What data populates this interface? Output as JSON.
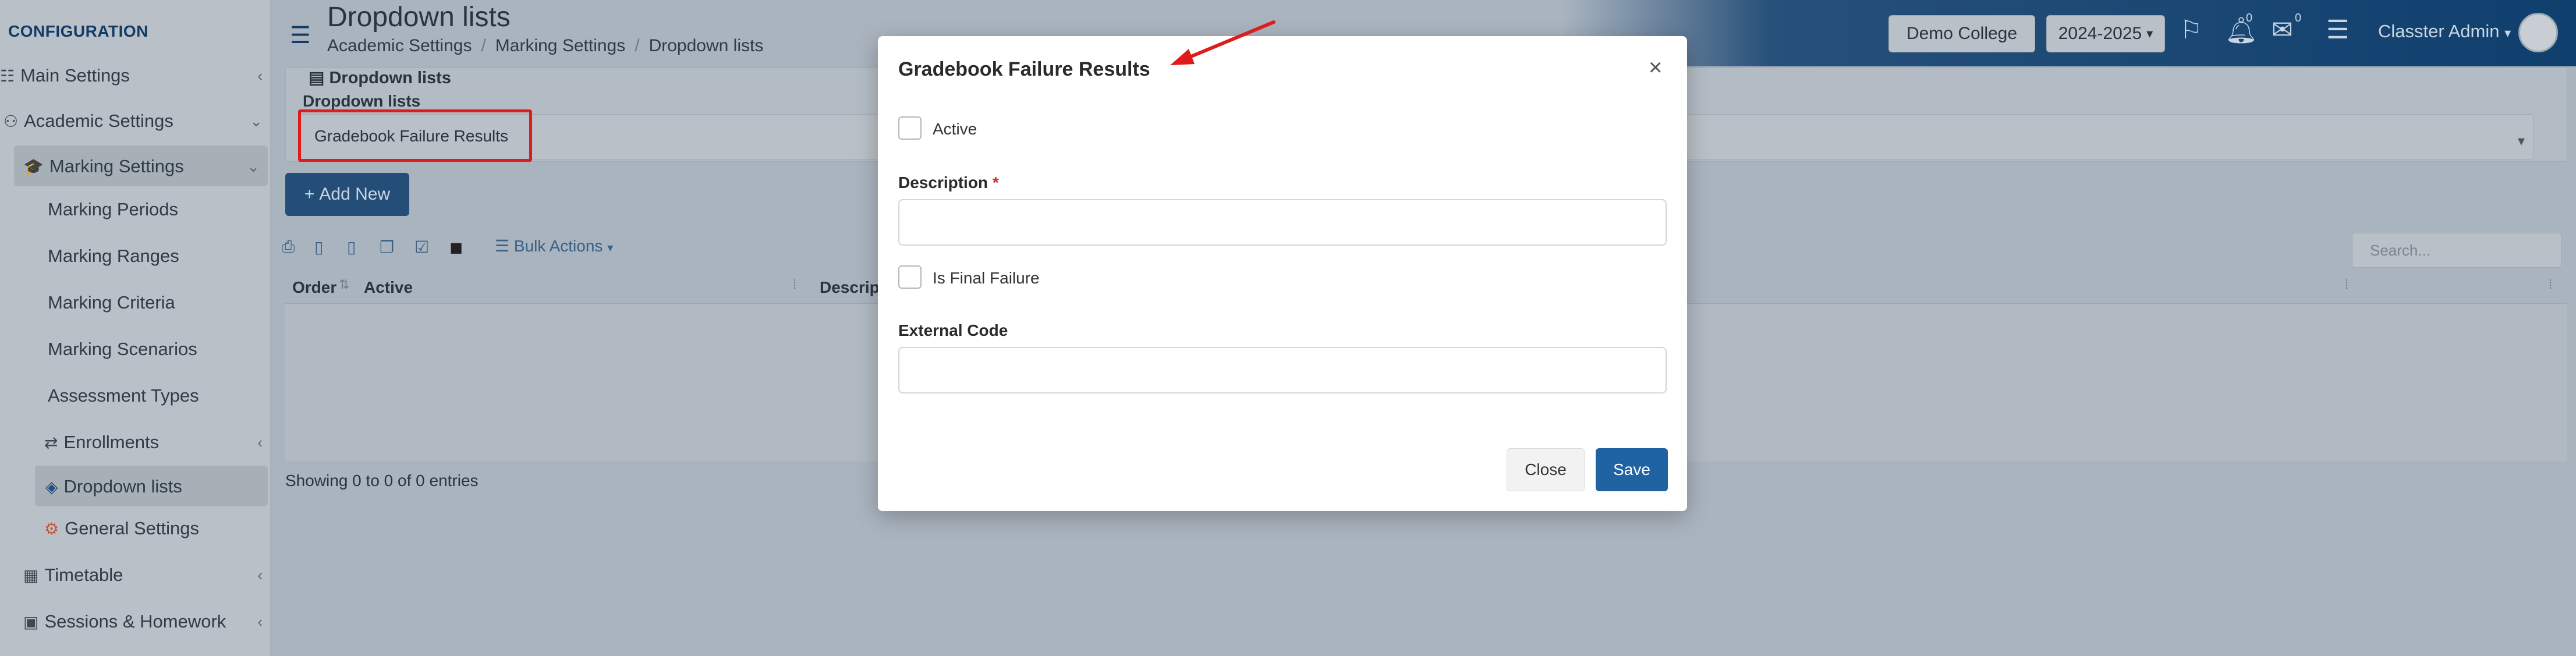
{
  "sidebar": {
    "title": "CONFIGURATION",
    "items": [
      {
        "label": "Main Settings"
      },
      {
        "label": "Academic Settings"
      },
      {
        "label": "Marking Settings"
      },
      {
        "label": "Marking Periods"
      },
      {
        "label": "Marking Ranges"
      },
      {
        "label": "Marking Criteria"
      },
      {
        "label": "Marking Scenarios"
      },
      {
        "label": "Assessment Types"
      },
      {
        "label": "Enrollments"
      },
      {
        "label": "Dropdown lists"
      },
      {
        "label": "General Settings"
      },
      {
        "label": "Timetable"
      },
      {
        "label": "Sessions & Homework"
      }
    ]
  },
  "header": {
    "title": "Dropdown lists",
    "breadcrumb": [
      "Academic Settings",
      "Marking Settings",
      "Dropdown lists"
    ],
    "college": "Demo College",
    "year": "2024-2025",
    "bell_count": "0",
    "mail_count": "0",
    "user": "Classter Admin"
  },
  "main": {
    "panel_title": "Dropdown lists",
    "panel_sub": "Dropdown lists",
    "selected_list": "Gradebook Failure Results",
    "add_new": "Add New",
    "bulk_actions": "Bulk Actions",
    "search_placeholder": "Search...",
    "columns": [
      "Order",
      "Active",
      "Descrip"
    ],
    "showing": "Showing 0 to 0 of 0 entries"
  },
  "modal": {
    "title": "Gradebook Failure Results",
    "active_label": "Active",
    "description_label": "Description",
    "is_final_failure_label": "Is Final Failure",
    "external_code_label": "External Code",
    "close_label": "Close",
    "save_label": "Save"
  },
  "colors": {
    "accent": "#1f63a3",
    "annotation_red": "#e01b1b"
  }
}
